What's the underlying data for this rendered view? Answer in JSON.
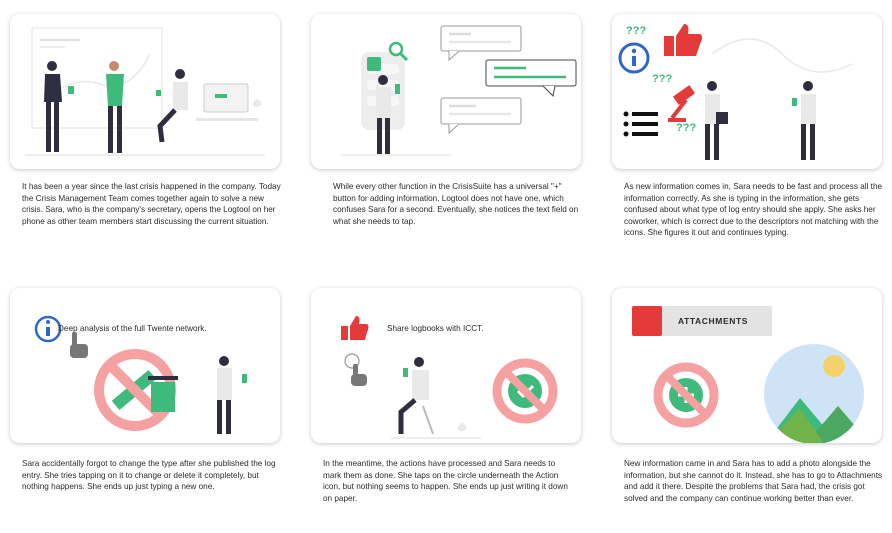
{
  "panels": [
    {
      "caption": "It has been a year since the last crisis happened in the company. Today the Crisis Management Team comes together again to solve a new crisis. Sara, who is the company's secretary, opens the Logtool on her phone as other team members start discussing the current situation."
    },
    {
      "caption": "While every other function in the CrisisSuite has a universal \"+\" button for adding information, Logtool does not have one, which confuses Sara for a second. Eventually, she notices the text field on what she needs to tap."
    },
    {
      "caption": "As new information comes in, Sara needs to be fast and process all the information correctly. As she is typing in the information, she gets confused about what type of log entry should she apply. She asks her coworker, which is correct due to the descriptors not matching with the icons. She figures it out and continues typing."
    },
    {
      "caption": "Sara accidentally forgot to change the type after she published the log entry. She tries tapping on it to change or delete it completely, but nothing happens. She ends up just typing a new one.",
      "label": "Deep analysis of the full Twente network."
    },
    {
      "caption": "In the meantime, the actions have processed and Sara needs to mark them as done. She taps on the circle underneath the Action icon, but nothing seems to happen. She ends up just writing it down on paper.",
      "label": "Share logbooks with ICCT."
    },
    {
      "caption": "New information came in and Sara has to add a photo alongside the information, but she cannot do it. Instead, she has to go to Attachments and add it there. Despite the problems that Sara had, the crisis got solved and the company can continue working better than ever.",
      "label": "ATTACHMENTS"
    }
  ],
  "icons": {
    "question": "???",
    "colors": {
      "green": "#3dba7c",
      "red": "#e43a3a",
      "blue": "#2f67c6",
      "pink": "#f6a1a1",
      "dark": "#2f2e41"
    }
  }
}
